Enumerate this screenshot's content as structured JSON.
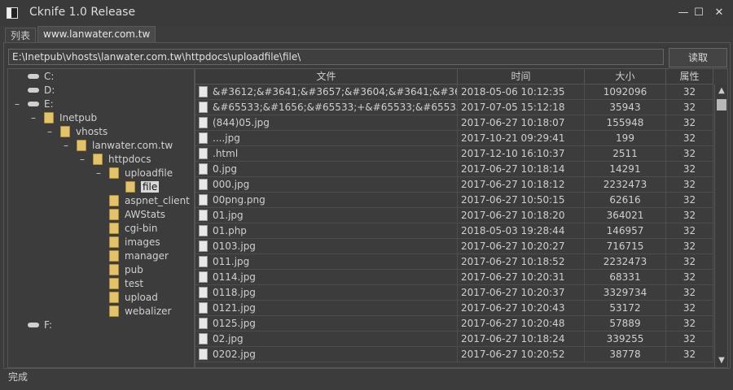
{
  "window": {
    "title": "Cknife 1.0 Release",
    "minimize": "—",
    "maximize": "☐",
    "close": "✕"
  },
  "tabs": [
    {
      "label": "列表"
    },
    {
      "label": "www.lanwater.com.tw"
    }
  ],
  "path_bar": {
    "value": "E:\\Inetpub\\vhosts\\lanwater.com.tw\\httpdocs\\uploadfile\\file\\",
    "button": "读取"
  },
  "tree": {
    "nodes": [
      {
        "label": "C:",
        "type": "drive",
        "expander": ""
      },
      {
        "label": "D:",
        "type": "drive",
        "expander": ""
      },
      {
        "label": "E:",
        "type": "drive",
        "expander": "–"
      },
      {
        "label": "Inetpub",
        "type": "folder",
        "expander": "–"
      },
      {
        "label": "vhosts",
        "type": "folder",
        "expander": "–"
      },
      {
        "label": "lanwater.com.tw",
        "type": "folder",
        "expander": "–"
      },
      {
        "label": "httpdocs",
        "type": "folder",
        "expander": "–"
      },
      {
        "label": "uploadfile",
        "type": "folder",
        "expander": "–"
      },
      {
        "label": "file",
        "type": "folder",
        "expander": "",
        "selected": true
      },
      {
        "label": "aspnet_client",
        "type": "folder",
        "expander": ""
      },
      {
        "label": "AWStats",
        "type": "folder",
        "expander": ""
      },
      {
        "label": "cgi-bin",
        "type": "folder",
        "expander": ""
      },
      {
        "label": "images",
        "type": "folder",
        "expander": ""
      },
      {
        "label": "manager",
        "type": "folder",
        "expander": ""
      },
      {
        "label": "pub",
        "type": "folder",
        "expander": ""
      },
      {
        "label": "test",
        "type": "folder",
        "expander": ""
      },
      {
        "label": "upload",
        "type": "folder",
        "expander": ""
      },
      {
        "label": "webalizer",
        "type": "folder",
        "expander": ""
      },
      {
        "label": "F:",
        "type": "drive",
        "expander": ""
      }
    ]
  },
  "files": {
    "columns": [
      "文件",
      "时间",
      "大小",
      "属性"
    ],
    "rows": [
      {
        "name": "&#3612;&#3641;&#3657;&#3604;&#3641;&#3649...",
        "time": "2018-05-06 10:12:35",
        "size": "1092096",
        "attr": "32"
      },
      {
        "name": "&#65533;&#1656;&#65533;+&#65533;&#65533;&#6553...",
        "time": "2017-07-05 15:12:18",
        "size": "35943",
        "attr": "32"
      },
      {
        "name": "(844)05.jpg",
        "time": "2017-06-27 10:18:07",
        "size": "155948",
        "attr": "32"
      },
      {
        "name": "....jpg",
        "time": "2017-10-21 09:29:41",
        "size": "199",
        "attr": "32"
      },
      {
        "name": ".html",
        "time": "2017-12-10 16:10:37",
        "size": "2511",
        "attr": "32"
      },
      {
        "name": "0.jpg",
        "time": "2017-06-27 10:18:14",
        "size": "14291",
        "attr": "32"
      },
      {
        "name": "000.jpg",
        "time": "2017-06-27 10:18:12",
        "size": "2232473",
        "attr": "32"
      },
      {
        "name": "00png.png",
        "time": "2017-06-27 10:50:15",
        "size": "62616",
        "attr": "32"
      },
      {
        "name": "01.jpg",
        "time": "2017-06-27 10:18:20",
        "size": "364021",
        "attr": "32"
      },
      {
        "name": "01.php",
        "time": "2018-05-03 19:28:44",
        "size": "146957",
        "attr": "32"
      },
      {
        "name": "0103.jpg",
        "time": "2017-06-27 10:20:27",
        "size": "716715",
        "attr": "32"
      },
      {
        "name": "011.jpg",
        "time": "2017-06-27 10:18:52",
        "size": "2232473",
        "attr": "32"
      },
      {
        "name": "0114.jpg",
        "time": "2017-06-27 10:20:31",
        "size": "68331",
        "attr": "32"
      },
      {
        "name": "0118.jpg",
        "time": "2017-06-27 10:20:37",
        "size": "3329734",
        "attr": "32"
      },
      {
        "name": "0121.jpg",
        "time": "2017-06-27 10:20:43",
        "size": "53172",
        "attr": "32"
      },
      {
        "name": "0125.jpg",
        "time": "2017-06-27 10:20:48",
        "size": "57889",
        "attr": "32"
      },
      {
        "name": "02.jpg",
        "time": "2017-06-27 10:18:24",
        "size": "339255",
        "attr": "32"
      },
      {
        "name": "0202.jpg",
        "time": "2017-06-27 10:20:52",
        "size": "38778",
        "attr": "32"
      }
    ]
  },
  "status": {
    "text": "完成"
  }
}
